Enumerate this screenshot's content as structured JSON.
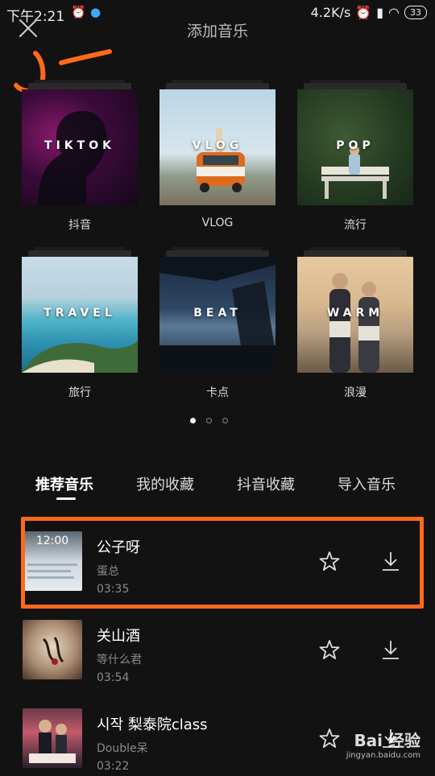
{
  "status_bar": {
    "time": "下午2:21",
    "speed": "4.2K/s",
    "battery": "33"
  },
  "header": {
    "title": "添加音乐"
  },
  "categories": [
    {
      "tag": "TIKTOK",
      "label": "抖音"
    },
    {
      "tag": "VLOG",
      "label": "VLOG"
    },
    {
      "tag": "POP",
      "label": "流行"
    },
    {
      "tag": "TRAVEL",
      "label": "旅行"
    },
    {
      "tag": "BEAT",
      "label": "卡点"
    },
    {
      "tag": "WARM",
      "label": "浪漫"
    }
  ],
  "pagination": {
    "pages": 3,
    "current": 1
  },
  "tabs": [
    {
      "label": "推荐音乐",
      "active": true
    },
    {
      "label": "我的收藏",
      "active": false
    },
    {
      "label": "抖音收藏",
      "active": false
    },
    {
      "label": "导入音乐",
      "active": false
    }
  ],
  "songs": [
    {
      "title": "公子呀",
      "artist": "蛋总",
      "duration": "03:35",
      "cover_text": "12:00"
    },
    {
      "title": "关山酒",
      "artist": "等什么君",
      "duration": "03:54",
      "cover_text": ""
    },
    {
      "title": "시작 梨泰院class",
      "artist": "Double呆",
      "duration": "03:22",
      "cover_text": ""
    }
  ],
  "watermark": {
    "brand": "Bai 经验",
    "url": "jingyan.baidu.com"
  },
  "colors": {
    "highlight": "#ff6a1a",
    "background": "#121212"
  }
}
